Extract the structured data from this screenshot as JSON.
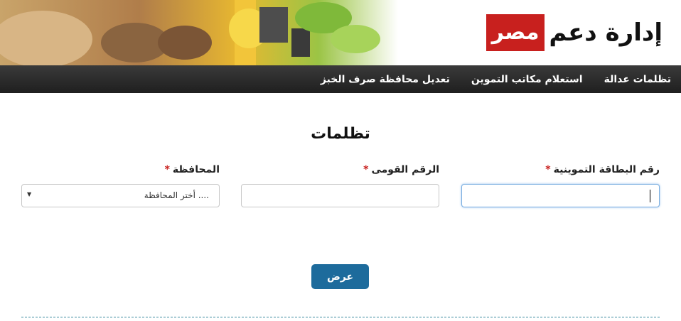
{
  "header": {
    "logo_text": "إدارة دعم",
    "logo_box": "مصر"
  },
  "nav": {
    "items": [
      "تظلمات عدالة",
      "استعلام مكاتب التموين",
      "تعديل محافظة صرف الخبز"
    ]
  },
  "page": {
    "title": "تظلمات"
  },
  "form": {
    "required_mark": "*",
    "card_number": {
      "label": "رقم البطاقة التموينية",
      "value": ""
    },
    "national_id": {
      "label": "الرقم القومى",
      "value": ""
    },
    "governorate": {
      "label": "المحافظة",
      "selected": ".... أختر المحافظة"
    },
    "submit_label": "عرض"
  },
  "colors": {
    "nav_bg": "#2b2b2b",
    "logo_red": "#c8201e",
    "button_blue": "#1d6b9c",
    "required_red": "#c8201e"
  }
}
